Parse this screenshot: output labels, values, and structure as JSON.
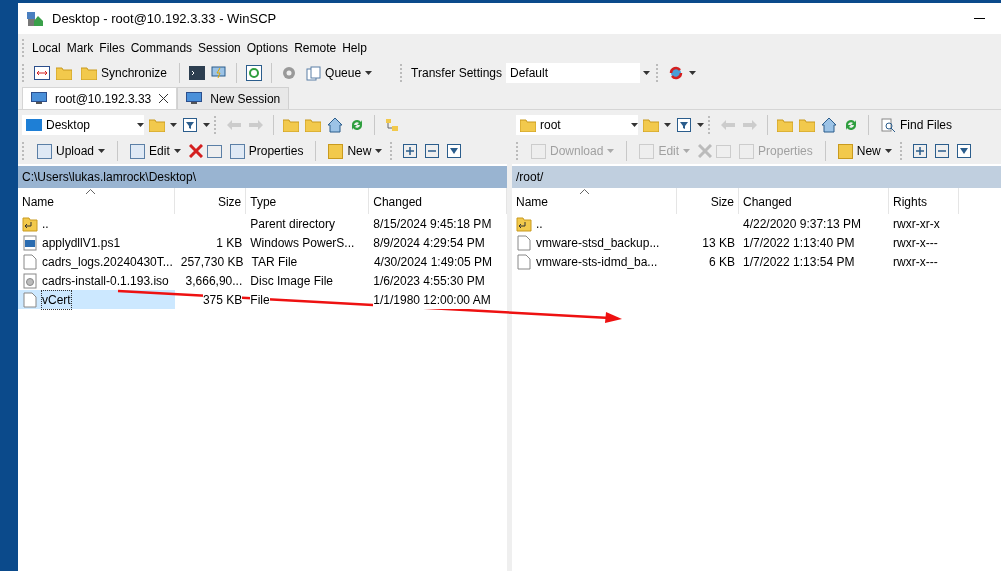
{
  "window": {
    "title": "Desktop - root@10.192.3.33 - WinSCP"
  },
  "menu": [
    "Local",
    "Mark",
    "Files",
    "Commands",
    "Session",
    "Options",
    "Remote",
    "Help"
  ],
  "toolbar": {
    "synchronize": "Synchronize",
    "queue": "Queue",
    "transfer_label": "Transfer Settings",
    "transfer_value": "Default"
  },
  "session_tabs": [
    {
      "label": "root@10.192.3.33",
      "selected": true
    },
    {
      "label": "New Session",
      "selected": false
    }
  ],
  "panels": [
    {
      "kind": "local",
      "location": "Desktop",
      "actions": [
        {
          "label": "Upload",
          "disabled": false
        },
        {
          "label": "Edit",
          "disabled": false
        },
        {
          "label": "Properties",
          "disabled": false
        },
        {
          "label": "New",
          "disabled": false
        }
      ],
      "path": "C:\\Users\\lukas.lamrock\\Desktop\\",
      "columns": [
        "Name",
        "Size",
        "Type",
        "Changed"
      ],
      "rows": [
        {
          "kind": "parent",
          "cells": [
            "..",
            "",
            "Parent directory",
            "8/15/2024  9:45:18 PM"
          ],
          "selected": false
        },
        {
          "kind": "script",
          "cells": [
            "applydllV1.ps1",
            "1 KB",
            "Windows PowerS...",
            "8/9/2024  4:29:54 PM"
          ],
          "selected": false
        },
        {
          "kind": "file",
          "cells": [
            "cadrs_logs.20240430T...",
            "257,730 KB",
            "TAR File",
            "4/30/2024  1:49:05 PM"
          ],
          "selected": false
        },
        {
          "kind": "disc",
          "cells": [
            "cadrs-install-0.1.193.iso",
            "3,666,90...",
            "Disc Image File",
            "1/6/2023  4:55:30 PM"
          ],
          "selected": false
        },
        {
          "kind": "file",
          "cells": [
            "vCert",
            "375 KB",
            "File",
            "1/1/1980  12:00:00 AM"
          ],
          "selected": true
        }
      ]
    },
    {
      "kind": "remote",
      "location": "root",
      "find": "Find Files",
      "actions": [
        {
          "label": "Download",
          "disabled": true
        },
        {
          "label": "Edit",
          "disabled": true
        },
        {
          "label": "Properties",
          "disabled": true
        },
        {
          "label": "New",
          "disabled": false
        }
      ],
      "path": "/root/",
      "columns": [
        "Name",
        "Size",
        "Changed",
        "Rights"
      ],
      "rows": [
        {
          "kind": "parent",
          "cells": [
            "..",
            "",
            "4/22/2020 9:37:13 PM",
            "rwxr-xr-x"
          ],
          "selected": false
        },
        {
          "kind": "file",
          "cells": [
            "vmware-stsd_backup...",
            "13 KB",
            "1/7/2022 1:13:40 PM",
            "rwxr-x---"
          ],
          "selected": false
        },
        {
          "kind": "file",
          "cells": [
            "vmware-sts-idmd_ba...",
            "6 KB",
            "1/7/2022 1:13:54 PM",
            "rwxr-x---"
          ],
          "selected": false
        }
      ]
    }
  ]
}
